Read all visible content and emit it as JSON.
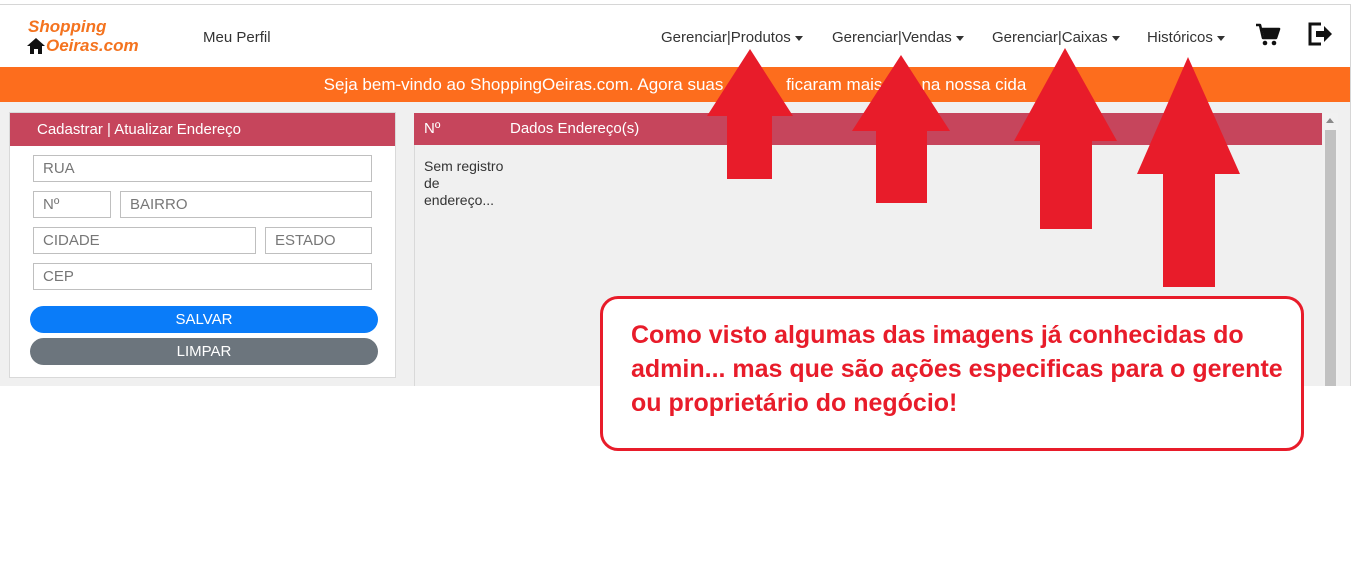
{
  "brand": {
    "line1": "Shopping",
    "line2": "Oeiras.com",
    "color": "#f4731f"
  },
  "nav": {
    "profile": "Meu Perfil",
    "menus": [
      {
        "label": "Gerenciar|Produtos"
      },
      {
        "label": "Gerenciar|Vendas"
      },
      {
        "label": "Gerenciar|Caixas"
      },
      {
        "label": "Históricos"
      }
    ],
    "icons": [
      "cart-icon",
      "logout-icon"
    ]
  },
  "banner": {
    "text": "Seja bem-vindo ao ShoppingOeiras.com. Agora suas co",
    "hidden_suffix": "ficaram mais",
    "hidden_suffix2": "is na nossa cida",
    "color": "#fd6d1d"
  },
  "address_form": {
    "title": "Cadastrar | Atualizar Endereço",
    "placeholders": {
      "street": "RUA",
      "number": "Nº",
      "district": "BAIRRO",
      "city": "CIDADE",
      "state": "ESTADO",
      "zip": "CEP"
    },
    "save_label": "SALVAR",
    "clear_label": "LIMPAR",
    "header_color": "#c6455c"
  },
  "address_table": {
    "columns": [
      "Nº",
      "Dados Endereço(s)"
    ],
    "empty_text": "Sem registro de endereço..."
  },
  "annotation": {
    "text": "Como visto algumas das imagens já conhecidas do admin... mas que são ações especificas para o gerente ou proprietário do negócio!",
    "color": "#e81c2a"
  }
}
